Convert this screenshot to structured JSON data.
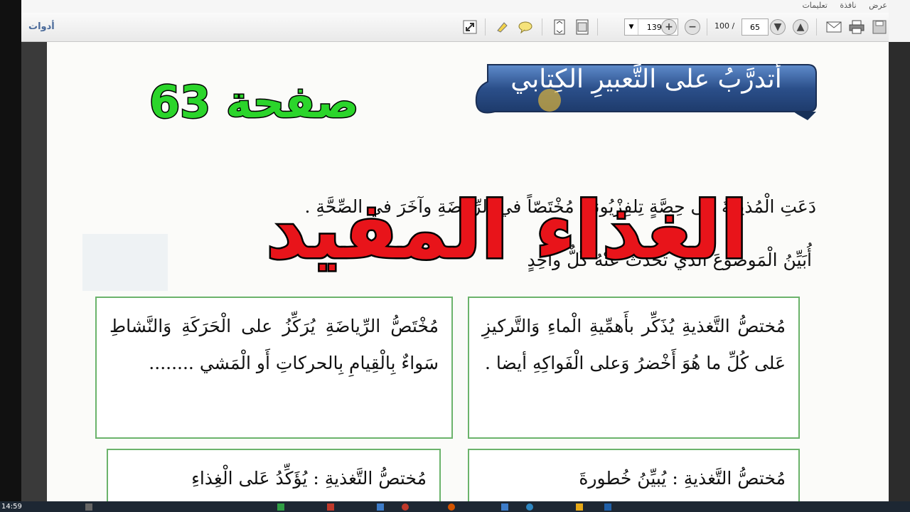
{
  "menu": {
    "items": [
      "عرض",
      "نافذة",
      "تعليمات"
    ]
  },
  "toolbar": {
    "tools_label": "أدوات",
    "zoom": "139%",
    "page_total": "100",
    "page_separator": "/",
    "current_page": "65"
  },
  "document": {
    "banner_title": "أتدرَّبُ على التَّعبيرِ الكِتابي",
    "page_label": "صفحة 63",
    "overlay_title": "الغذاء المفيد",
    "prompt_line1": "دَعَتِ الْمُذيعَةُ إلى حِصَّةٍ تِلفِزْيُونيَّةٍ مُخْتَصّاً في الرِّياضَةِ وآخَرَ في الصِّحَّةِ .",
    "prompt_line2": "أُبَيِّنُ الْمَوضوعَ الّذي تحَدَّثَ عَنْهُ كُلٌّ واحِدٍ",
    "boxes": [
      {
        "text": "مُختصُّ التَّغذيةِ يُذَكِّر بأَهمِّيةِ الْماءِ وَالتَّركيزِ عَلى كُلِّ ما هُوَ أَخْضرُ وَعلى الْفَواكِهِ أيضا ."
      },
      {
        "text": "مُخْتَصُّ الرِّياضَةِ يُرَكِّزُ على الْحَرَكَةِ وَالنَّشاطِ سَواءٌ بِالْقِيامِ بِالحركاتِ أَو الْمَشي ........"
      },
      {
        "text": "مُختصُّ التَّغذيةِ : يُبيِّنُ خُطورةَ"
      },
      {
        "text": "مُختصُّ التَّغذيةِ : يُؤَكِّدُ عَلى الْغِذاءِ"
      }
    ]
  },
  "taskbar": {
    "time": "14:59"
  },
  "colors": {
    "banner": "#2b4f8a",
    "page_label": "#2bd52b",
    "overlay_title": "#e8141a",
    "box_border": "#6bb36b"
  }
}
